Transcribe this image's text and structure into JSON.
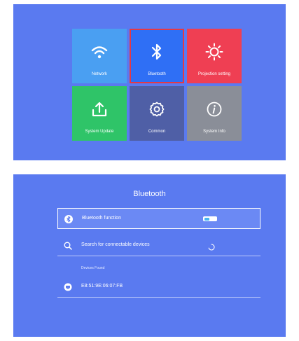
{
  "menu": {
    "tiles": [
      {
        "label": "Network",
        "icon": "wifi-icon",
        "color": "#4a9ff2"
      },
      {
        "label": "Bluetooth",
        "icon": "bluetooth-icon",
        "color": "#2f6ff5",
        "selected": true
      },
      {
        "label": "Projection setting",
        "icon": "brightness-icon",
        "color": "#ef3f53"
      },
      {
        "label": "System Update",
        "icon": "upload-icon",
        "color": "#2fc468"
      },
      {
        "label": "Common",
        "icon": "gear-icon",
        "color": "#4f5fa6"
      },
      {
        "label": "System Info",
        "icon": "info-icon",
        "color": "#8a8e98"
      }
    ],
    "selection_color": "#e53945"
  },
  "bluetooth": {
    "title": "Bluetooth",
    "function_label": "Bluetooth function",
    "toggle_on": true,
    "search_label": "Search for connectable devices",
    "devices_found_label": "Devices Found",
    "devices": [
      {
        "name": "E8:51:9E:06:07:FB",
        "icon": "device-icon"
      }
    ]
  },
  "colors": {
    "background": "#5a7af0",
    "accent": "#48b7ef"
  }
}
